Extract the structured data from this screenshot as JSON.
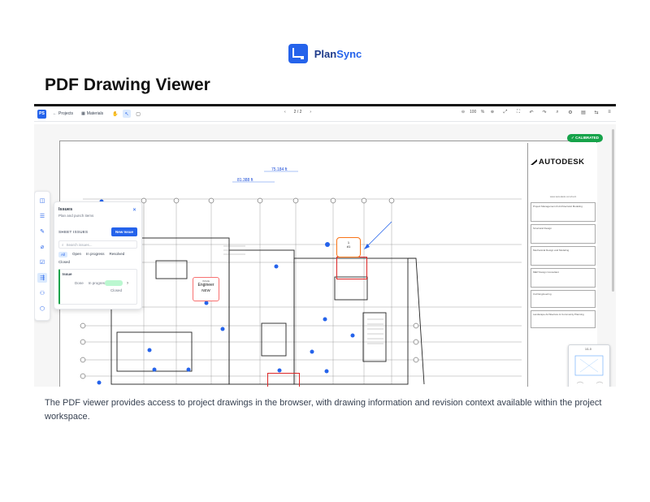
{
  "brand": {
    "name_prefix": "Plan",
    "name_suffix": "Sync"
  },
  "page_title": "PDF Drawing Viewer",
  "toolbar": {
    "badge": "PS",
    "projects_label": "Projects",
    "materials_label": "Materials",
    "page_indicator": "2 / 2",
    "zoom_value": "100"
  },
  "badge": {
    "calibrated": "CALIBRATED",
    "color": "#16a34a"
  },
  "issues_panel": {
    "title": "Issues",
    "subtitle": "Plan and punch items",
    "section_label": "SHEET ISSUES",
    "new_issue_label": "New Issue",
    "search_placeholder": "Search issues...",
    "filters": [
      "All",
      "Open",
      "In progress",
      "Resolved",
      "Closed"
    ],
    "card": {
      "name": "Issue",
      "type": "Done",
      "status": "In progress",
      "status_label": "Closed"
    }
  },
  "markers": {
    "engineer": {
      "small": "ISSUE",
      "role": "Engineer",
      "status": "NEW"
    },
    "rfi": {
      "num": "1",
      "tag": "#1"
    }
  },
  "dimensions": [
    "81.388 ft",
    "75.184 ft"
  ],
  "titleblock": {
    "logo": "AUTODESK",
    "url": "www.autodesk.com/revit",
    "cells": [
      "Project Management & Architectural Modeling",
      "Structural Design",
      "Mechanical Design and Modeling",
      "MEP Design Consultant",
      "Civil Engineering",
      "Landscape Architecture & Community Planning"
    ]
  },
  "map_card": {
    "label": "1/1.0"
  },
  "caption": "The PDF viewer provides access to project drawings in the browser, with drawing information and revision context available within the project workspace.",
  "colors": {
    "accent": "#2563eb",
    "issue_red": "#dc2626",
    "success": "#16a34a"
  }
}
